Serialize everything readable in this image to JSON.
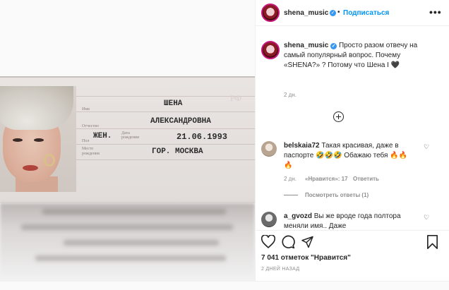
{
  "post": {
    "passport": {
      "rf_mark": "РФ",
      "labels": {
        "name": "Имя",
        "patronymic": "Отчество",
        "sex": "Пол",
        "dob": "Дата рождения",
        "pob": "Место рождения"
      },
      "given_name": "ШЕНА",
      "patronymic": "АЛЕКСАНДРОВНА",
      "sex": "ЖЕН.",
      "dob": "21.06.1993",
      "pob": "ГОР. МОСКВА"
    }
  },
  "header": {
    "username": "shena_music",
    "separator": "•",
    "follow_label": "Подписаться",
    "more_label": "•••"
  },
  "caption": {
    "username": "shena_music",
    "text": "Просто разом отвечу на самый популярный вопрос. Почему «SHENA?» ? Потому что Шена I 🖤",
    "time": "2 дн."
  },
  "comments": [
    {
      "username": "belskaia72",
      "text": "Такая красивая, даже в паспорте 🤣🤣🤣 Обажаю тебя 🔥🔥🔥",
      "time": "2 дн.",
      "likes": "«Нравится»: 17",
      "reply": "Ответить",
      "view_replies": "Посмотреть ответы (1)"
    },
    {
      "username": "a_gvozd",
      "text": "Вы же вроде года полтора меняли имя.. Даже"
    }
  ],
  "footer": {
    "likes": "7 041 отметок \"Нравится\"",
    "timestamp": "2 ДНЕЙ НАЗАД"
  },
  "icons": {
    "heart": "heart-icon",
    "comment": "comment-icon",
    "share": "share-icon",
    "bookmark": "bookmark-icon",
    "verified": "verified-badge-icon",
    "load_more": "plus-circle-icon"
  }
}
